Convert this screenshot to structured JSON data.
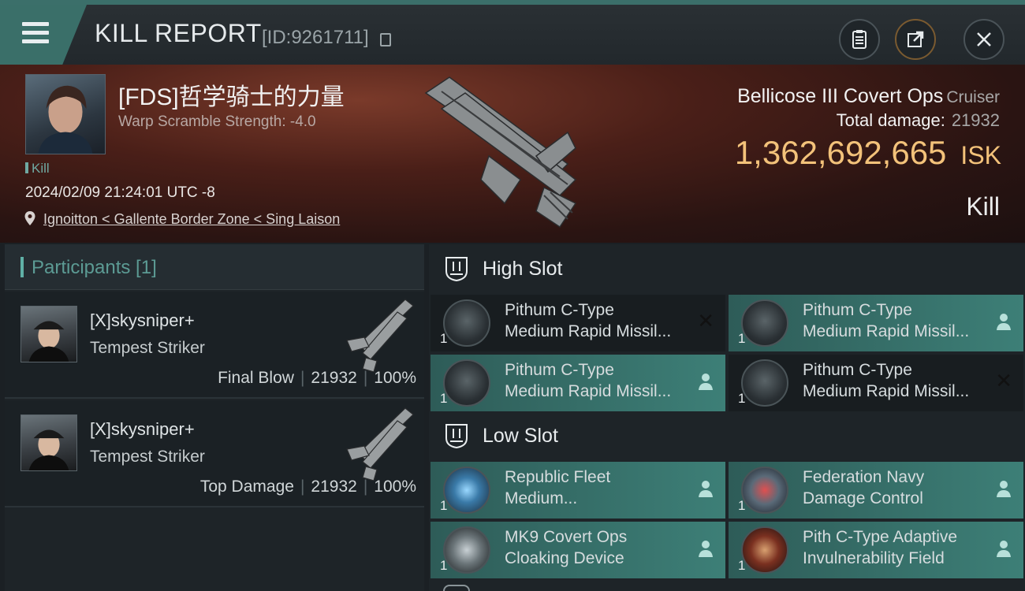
{
  "topbar": {
    "title": "KILL REPORT",
    "report_id": "[ID:9261711]",
    "icons": [
      "menu-icon",
      "clipboard-icon",
      "share-icon",
      "close-icon"
    ]
  },
  "victim": {
    "name": "[FDS]哲学骑士的力量",
    "warp_scramble": "Warp Scramble Strength: -4.0",
    "tag": "Kill",
    "datetime": "2024/02/09 21:24:01 UTC -8",
    "location": "Ignoitton < Gallente Border Zone < Sing Laison"
  },
  "ship": {
    "name": "Bellicose III Covert Ops",
    "class": "Cruiser",
    "total_damage_label": "Total damage:",
    "total_damage": "21932",
    "isk_value": "1,362,692,665",
    "isk_unit": "ISK",
    "result": "Kill"
  },
  "participants": {
    "header": "Participants [1]",
    "rows": [
      {
        "name": "[X]skysniper+",
        "ship": "Tempest Striker",
        "role": "Final Blow",
        "damage": "21932",
        "percent": "100%"
      },
      {
        "name": "[X]skysniper+",
        "ship": "Tempest Striker",
        "role": "Top Damage",
        "damage": "21932",
        "percent": "100%"
      }
    ]
  },
  "fitting": {
    "high_slot": {
      "title": "High Slot",
      "modules": [
        {
          "line1": "Pithum C-Type",
          "line2": "Medium Rapid Missil...",
          "qty": "1",
          "state": "destroyed"
        },
        {
          "line1": "Pithum C-Type",
          "line2": "Medium Rapid Missil...",
          "qty": "1",
          "state": "dropped"
        },
        {
          "line1": "Pithum C-Type",
          "line2": "Medium Rapid Missil...",
          "qty": "1",
          "state": "dropped"
        },
        {
          "line1": "Pithum C-Type",
          "line2": "Medium Rapid Missil...",
          "qty": "1",
          "state": "destroyed"
        }
      ]
    },
    "low_slot": {
      "title": "Low Slot",
      "modules": [
        {
          "line1": "Republic Fleet",
          "line2": "Medium...",
          "qty": "1",
          "state": "dropped"
        },
        {
          "line1": "Federation Navy",
          "line2": "Damage Control",
          "qty": "1",
          "state": "dropped"
        },
        {
          "line1": "MK9 Covert Ops",
          "line2": "Cloaking Device",
          "qty": "1",
          "state": "dropped"
        },
        {
          "line1": "Pith C-Type Adaptive",
          "line2": "Invulnerability Field",
          "qty": "1",
          "state": "dropped"
        }
      ]
    }
  },
  "colors": {
    "accent_teal": "#3d7f77",
    "isk_gold": "#f3c27a",
    "participants_header": "#5c9b94"
  }
}
